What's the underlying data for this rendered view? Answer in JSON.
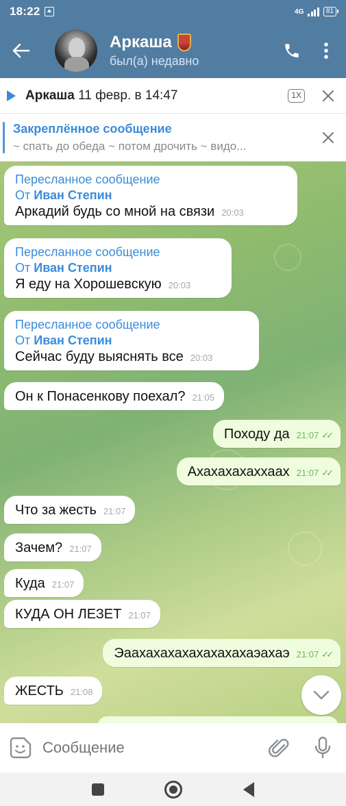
{
  "status_bar": {
    "time": "18:22",
    "network": "4G",
    "battery": "81"
  },
  "header": {
    "name": "Аркаша",
    "status": "был(а) недавно"
  },
  "player": {
    "author": "Аркаша",
    "date": "11 февр. в 14:47",
    "speed": "1X"
  },
  "pinned": {
    "title": "Закреплённое сообщение",
    "preview": "~ спать до обеда ~ потом дрочить ~ видо..."
  },
  "messages": [
    {
      "dir": "in",
      "forwarded_label": "Пересланное сообщение",
      "from_prefix": "От",
      "from_name": "Иван Степин",
      "text": "Аркадий будь со мной на связи",
      "time": "20:03"
    },
    {
      "dir": "in",
      "forwarded_label": "Пересланное сообщение",
      "from_prefix": "От",
      "from_name": "Иван Степин",
      "text": "Я еду на Хорошевскую",
      "time": "20:03"
    },
    {
      "dir": "in",
      "forwarded_label": "Пересланное сообщение",
      "from_prefix": "От",
      "from_name": "Иван Степин",
      "text": "Сейчас буду выяснять все",
      "time": "20:03"
    },
    {
      "dir": "in",
      "text": "Он к Понасенкову поехал?",
      "time": "21:05"
    },
    {
      "dir": "out",
      "text": "Походу да",
      "time": "21:07",
      "ticks": "✓✓"
    },
    {
      "dir": "out",
      "text": "Ахахахахаххаах",
      "time": "21:07",
      "ticks": "✓✓"
    },
    {
      "dir": "in",
      "text": "Что за жесть",
      "time": "21:07"
    },
    {
      "dir": "in",
      "text": "Зачем?",
      "time": "21:07"
    },
    {
      "dir": "in",
      "text": "Куда",
      "time": "21:07"
    },
    {
      "dir": "in",
      "text": "КУДА ОН ЛЕЗЕТ",
      "time": "21:07"
    },
    {
      "dir": "out",
      "text": "Эаахахахахахахахахаэахаэ",
      "time": "21:07",
      "ticks": "✓✓"
    },
    {
      "dir": "in",
      "text": "ЖЕСТЬ",
      "time": "21:08"
    }
  ],
  "composer": {
    "placeholder": "Сообщение"
  },
  "colors": {
    "header_bg": "#527da3",
    "accent": "#3a8cd9",
    "out_bubble": "#effdde",
    "tick": "#5fb04b"
  }
}
